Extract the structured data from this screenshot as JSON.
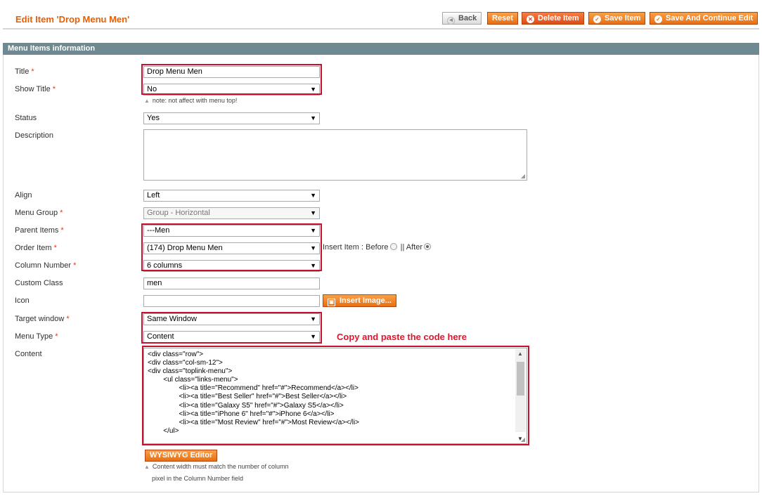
{
  "header": {
    "title": "Edit Item 'Drop Menu Men'",
    "buttons": {
      "back": "Back",
      "reset": "Reset",
      "delete": "Delete Item",
      "save": "Save Item",
      "save_continue": "Save And Continue Edit"
    }
  },
  "section": {
    "title": "Menu Items information"
  },
  "form": {
    "title": {
      "label": "Title",
      "value": "Drop Menu Men"
    },
    "show_title": {
      "label": "Show Title",
      "value": "No",
      "note": "note: not affect with menu top!"
    },
    "status": {
      "label": "Status",
      "value": "Yes"
    },
    "description": {
      "label": "Description",
      "value": ""
    },
    "align": {
      "label": "Align",
      "value": "Left"
    },
    "menu_group": {
      "label": "Menu Group",
      "value": "Group - Horizontal"
    },
    "parent_items": {
      "label": "Parent Items",
      "value": "---Men"
    },
    "order_item": {
      "label": "Order Item",
      "value": "(174) Drop Menu Men",
      "insert_label": "Insert Item : Before",
      "after_label": "|| After",
      "selected": "After"
    },
    "column_number": {
      "label": "Column Number",
      "value": "6 columns"
    },
    "custom_class": {
      "label": "Custom Class",
      "value": "men"
    },
    "icon": {
      "label": "Icon",
      "value": "",
      "button": "Insert Image..."
    },
    "target_window": {
      "label": "Target window",
      "value": "Same Window"
    },
    "menu_type": {
      "label": "Menu Type",
      "value": "Content"
    },
    "content": {
      "label": "Content",
      "code": "<div class=\"row\">\n<div class=\"col-sm-12\">\n<div class=\"toplink-menu\">\n        <ul class=\"links-menu\">\n                <li><a title=\"Recommend\" href=\"#\">Recommend</a></li>\n                <li><a title=\"Best Seller\" href=\"#\">Best Seller</a></li>\n                <li><a title=\"Galaxy S5\" href=\"#\">Galaxy S5</a></li>\n                <li><a title=\"iPhone 6\" href=\"#\">iPhone 6</a></li>\n                <li><a title=\"Most Review\" href=\"#\">Most Review</a></li>\n        </ul>",
      "wysiwyg_button": "WYSIWYG Editor",
      "note_line1": "Content width must match the number of column",
      "note_line2": "pixel in the Column Number field"
    }
  },
  "annotation": {
    "text": "Copy and paste the code here"
  },
  "colors": {
    "accent": "#eb5e00",
    "highlight": "#c8102e",
    "section_bar": "#6f8992"
  }
}
